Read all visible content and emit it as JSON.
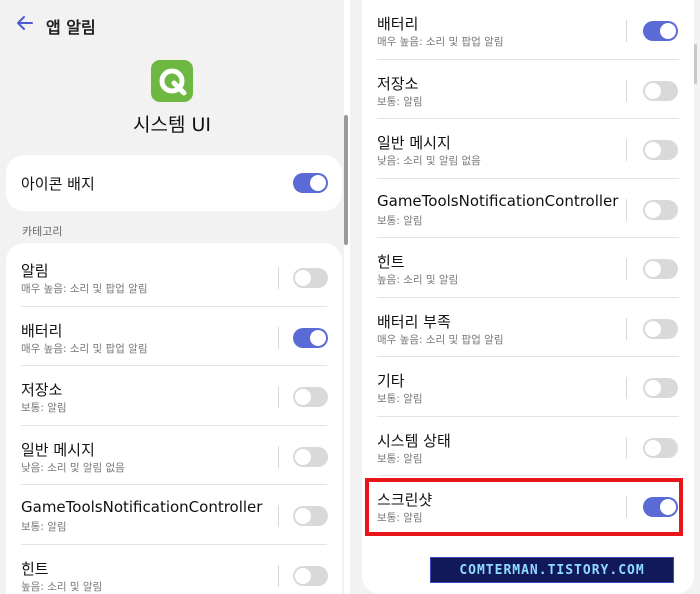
{
  "header": {
    "title": "앱 알림"
  },
  "app": {
    "name": "시스템 UI"
  },
  "badge": {
    "label": "아이콘 배지",
    "enabled": true
  },
  "section": {
    "label": "카테고리"
  },
  "left_categories": [
    {
      "title": "알림",
      "subtitle": "매우 높음: 소리 및 팝업 알림",
      "enabled": false
    },
    {
      "title": "배터리",
      "subtitle": "매우 높음: 소리 및 팝업 알림",
      "enabled": true
    },
    {
      "title": "저장소",
      "subtitle": "보통: 알림",
      "enabled": false
    },
    {
      "title": "일반 메시지",
      "subtitle": "낮음: 소리 및 알림 없음",
      "enabled": false
    },
    {
      "title": "GameToolsNotificationController",
      "subtitle": "보통: 알림",
      "enabled": false
    },
    {
      "title": "힌트",
      "subtitle": "높음: 소리 및 알림",
      "enabled": false
    }
  ],
  "right_categories": [
    {
      "title": "배터리",
      "subtitle": "매우 높음: 소리 및 팝업 알림",
      "enabled": true
    },
    {
      "title": "저장소",
      "subtitle": "보통: 알림",
      "enabled": false
    },
    {
      "title": "일반 메시지",
      "subtitle": "낮음: 소리 및 알림 없음",
      "enabled": false
    },
    {
      "title": "GameToolsNotificationController",
      "subtitle": "보통: 알림",
      "enabled": false
    },
    {
      "title": "힌트",
      "subtitle": "높음: 소리 및 알림",
      "enabled": false
    },
    {
      "title": "배터리 부족",
      "subtitle": "매우 높음: 소리 및 팝업 알림",
      "enabled": false
    },
    {
      "title": "기타",
      "subtitle": "보통: 알림",
      "enabled": false
    },
    {
      "title": "시스템 상태",
      "subtitle": "보통: 알림",
      "enabled": false
    },
    {
      "title": "스크린샷",
      "subtitle": "보통: 알림",
      "enabled": true
    }
  ],
  "watermark": {
    "text": "COMTERMAN.TISTORY.COM"
  },
  "colors": {
    "toggle_on": "#5b6bd6",
    "toggle_off": "#d9d9d9",
    "highlight": "#e8161b",
    "app_icon": "#6cb841",
    "back_arrow": "#4a5bd1"
  }
}
